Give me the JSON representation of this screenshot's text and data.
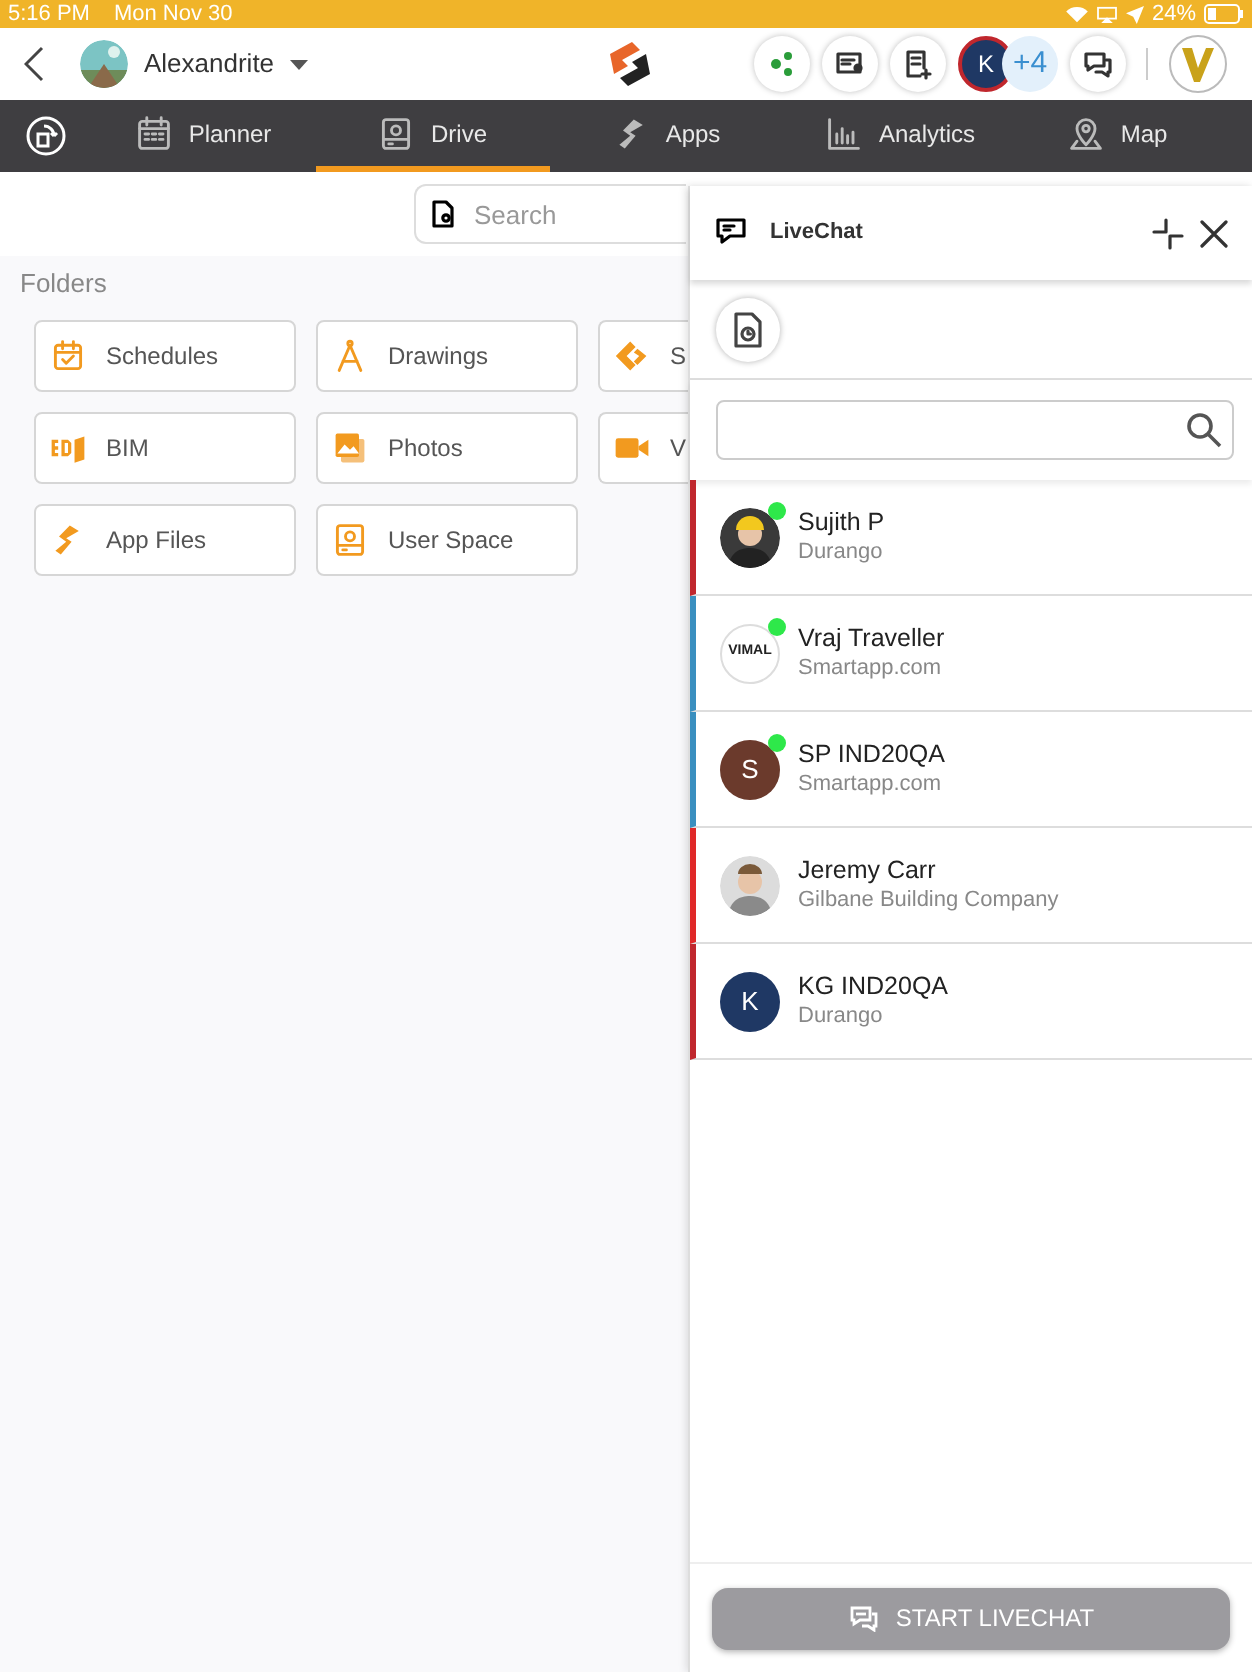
{
  "status_bar": {
    "time": "5:16 PM",
    "date": "Mon Nov 30",
    "battery": "24%"
  },
  "header": {
    "project": {
      "name": "Alexandrite"
    },
    "team": {
      "initial": "K",
      "more": "+4"
    }
  },
  "nav_tabs": [
    {
      "label": "Planner",
      "selected": false
    },
    {
      "label": "Drive",
      "selected": true
    },
    {
      "label": "Apps",
      "selected": false
    },
    {
      "label": "Analytics",
      "selected": false
    },
    {
      "label": "Map",
      "selected": false
    }
  ],
  "search": {
    "placeholder": "Search"
  },
  "folders": {
    "title": "Folders",
    "items": [
      {
        "label": "Schedules"
      },
      {
        "label": "Drawings"
      },
      {
        "label": "S"
      },
      {
        "label": "BIM"
      },
      {
        "label": "Photos"
      },
      {
        "label": "V"
      },
      {
        "label": "App Files"
      },
      {
        "label": "User Space"
      }
    ]
  },
  "livechat": {
    "title": "LiveChat",
    "contacts": [
      {
        "name": "Sujith P",
        "company": "Durango",
        "online": true,
        "color": "#c0272d"
      },
      {
        "name": "Vraj Traveller",
        "company": "Smartapp.com",
        "kind": "logo",
        "logo_text": "VIMAL",
        "online": true,
        "color": "#3a8fbf"
      },
      {
        "name": "SP IND20QA",
        "company": "Smartapp.com",
        "kind": "initial",
        "initial": "S",
        "online": true,
        "color": "#3a8fbf"
      },
      {
        "name": "Jeremy Carr",
        "company": "Gilbane Building Company",
        "online": false,
        "color": "#e02828"
      },
      {
        "name": "KG IND20QA",
        "company": "Durango",
        "kind": "initial",
        "initial": "K",
        "online": false,
        "color": "#c0272d"
      }
    ],
    "start_button": {
      "label": "START LIVECHAT",
      "disabled": true
    }
  }
}
